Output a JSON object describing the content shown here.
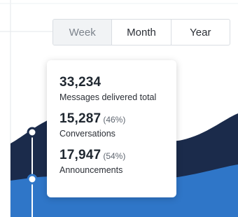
{
  "colors": {
    "conversations_area": "#1b2b4b",
    "announcements_area": "#2f76c8",
    "tooltip_bg": "#ffffff",
    "gridline": "#e3e7eb",
    "selected_tab_bg": "#f1f3f5"
  },
  "period_tabs": {
    "items": [
      "Week",
      "Month",
      "Year"
    ],
    "selected": "Week"
  },
  "tooltip": {
    "total_value": "33,234",
    "total_label": "Messages delivered total",
    "conversations_value": "15,287",
    "conversations_pct": "(46%)",
    "conversations_label": "Conversations",
    "announcements_value": "17,947",
    "announcements_pct": "(54%)",
    "announcements_label": "Announcements"
  }
}
